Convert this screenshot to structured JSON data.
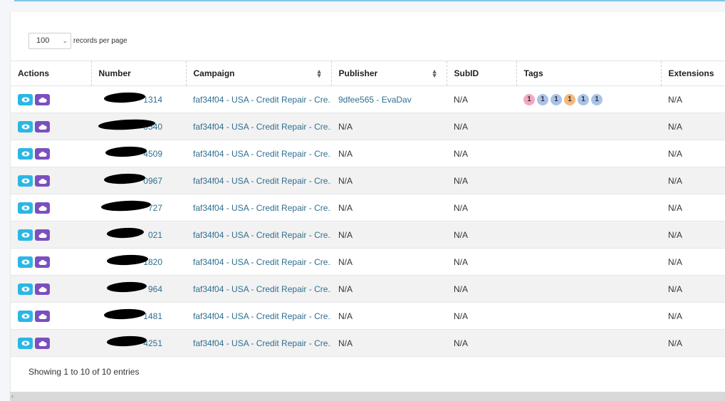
{
  "length": {
    "value": "100",
    "label": "records per page"
  },
  "columns": [
    "Actions",
    "Number",
    "Campaign",
    "Publisher",
    "SubID",
    "Tags",
    "Extensions"
  ],
  "rows": [
    {
      "number": "1314",
      "campaign": "faf34f04 - USA - Credit Repair - Cre...",
      "publisher": "9dfee565 - EvaDav",
      "subid": "N/A",
      "extensions": "N/A",
      "tags": [
        {
          "label": "1",
          "color": "#f4a6c4"
        },
        {
          "label": "1",
          "color": "#a9c2e8"
        },
        {
          "label": "1",
          "color": "#a9c2e8"
        },
        {
          "label": "1",
          "color": "#f6b77a"
        },
        {
          "label": "1",
          "color": "#a9c2e8"
        },
        {
          "label": "1",
          "color": "#a9c2e8"
        }
      ]
    },
    {
      "number": "0540",
      "campaign": "faf34f04 - USA - Credit Repair - Cre...",
      "publisher": "N/A",
      "subid": "N/A",
      "extensions": "N/A",
      "tags": []
    },
    {
      "number": "4509",
      "campaign": "faf34f04 - USA - Credit Repair - Cre...",
      "publisher": "N/A",
      "subid": "N/A",
      "extensions": "N/A",
      "tags": []
    },
    {
      "number": "0967",
      "campaign": "faf34f04 - USA - Credit Repair - Cre...",
      "publisher": "N/A",
      "subid": "N/A",
      "extensions": "N/A",
      "tags": []
    },
    {
      "number": "727",
      "campaign": "faf34f04 - USA - Credit Repair - Cre...",
      "publisher": "N/A",
      "subid": "N/A",
      "extensions": "N/A",
      "tags": []
    },
    {
      "number": "021",
      "campaign": "faf34f04 - USA - Credit Repair - Cre...",
      "publisher": "N/A",
      "subid": "N/A",
      "extensions": "N/A",
      "tags": []
    },
    {
      "number": "1820",
      "campaign": "faf34f04 - USA - Credit Repair - Cre...",
      "publisher": "N/A",
      "subid": "N/A",
      "extensions": "N/A",
      "tags": []
    },
    {
      "number": "964",
      "campaign": "faf34f04 - USA - Credit Repair - Cre...",
      "publisher": "N/A",
      "subid": "N/A",
      "extensions": "N/A",
      "tags": []
    },
    {
      "number": "1481",
      "campaign": "faf34f04 - USA - Credit Repair - Cre...",
      "publisher": "N/A",
      "subid": "N/A",
      "extensions": "N/A",
      "tags": []
    },
    {
      "number": "4251",
      "campaign": "faf34f04 - USA - Credit Repair - Cre...",
      "publisher": "N/A",
      "subid": "N/A",
      "extensions": "N/A",
      "tags": []
    }
  ],
  "info": "Showing 1 to 10 of 10 entries",
  "icons": {
    "view": "eye-icon",
    "cloud": "cloud-icon",
    "sort": "sort-icon",
    "select_chevron": "chevron-down-icon",
    "scroll_left": "chevron-left-icon"
  },
  "colors": {
    "view_button": "#2ab7e6",
    "cloud_button": "#7b4fbf",
    "link": "#2f6f8f"
  }
}
